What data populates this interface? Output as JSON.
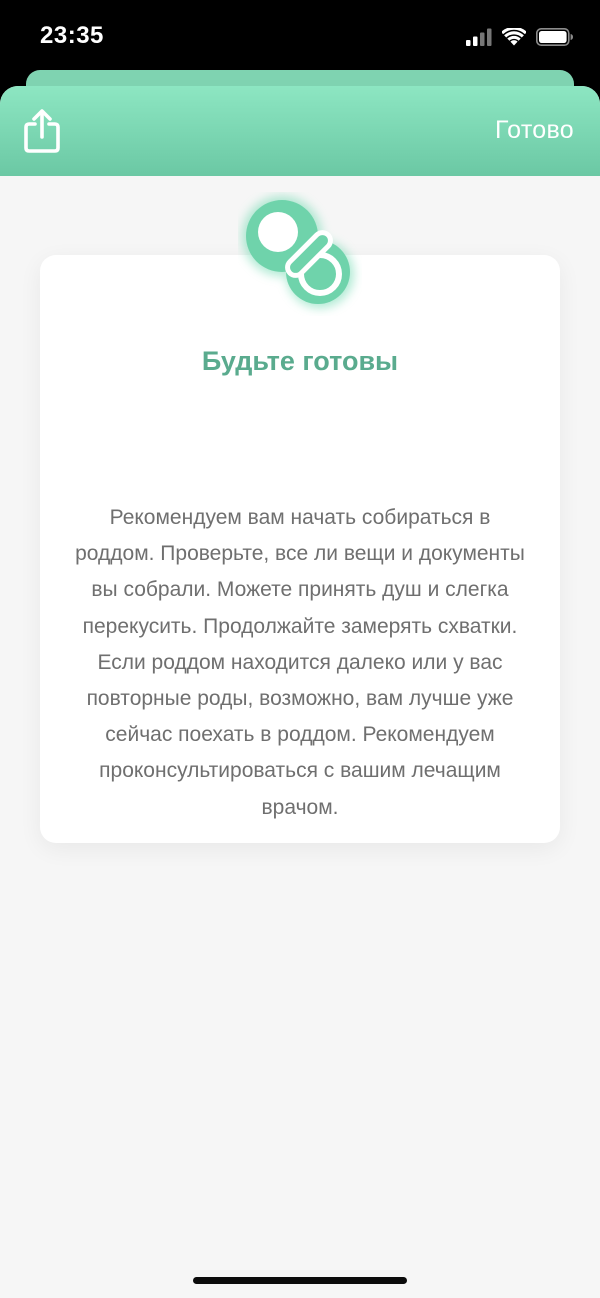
{
  "status_bar": {
    "time": "23:35"
  },
  "header": {
    "share_icon": "share-icon",
    "done_label": "Готово"
  },
  "card": {
    "icon": "pacifier-icon",
    "title": "Будьте готовы",
    "text": "Рекомендуем вам начать собираться в роддом. Проверьте, все ли вещи и документы вы собрали. Можете принять душ и слегка перекусить. Продолжайте замерять схватки. Если роддом находится далеко или у вас повторные роды, возможно, вам лучше уже сейчас поехать в роддом. Рекомендуем проконсультироваться с вашим лечащим врачом."
  },
  "colors": {
    "accent": "#6bc8a4",
    "title": "#5aab8e",
    "text": "#6f6f6f",
    "background": "#f6f6f6"
  }
}
